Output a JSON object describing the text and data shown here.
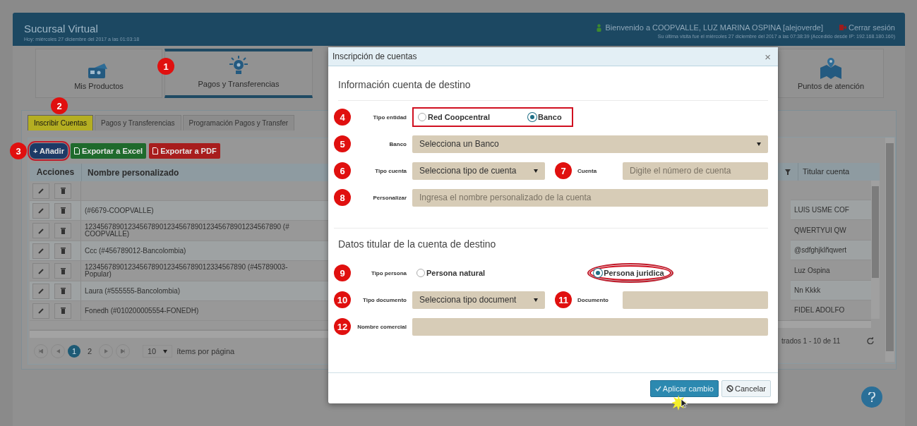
{
  "header": {
    "title": "Sucursal Virtual",
    "date_line": "Hoy: miércoles 27 diciembre del 2017 a las 01:03:18",
    "welcome": "Bienvenido a COOPVALLE, LUZ MARINA OSPINA [alejoverde]",
    "logout": "Cerrar sesión",
    "last_visit": "Su última visita fue el miércoles 27 diciembre del 2017 a las 07:38:39 (Accedido desde IP: 192.168.180.160)"
  },
  "nav": [
    {
      "label": "Mis Productos",
      "kind": "wallet",
      "selected": false
    },
    {
      "label": "Pagos y Transferencias",
      "kind": "bulb",
      "selected": true,
      "marker": "1"
    },
    {
      "label": "Puntos de atención",
      "kind": "map",
      "selected": false
    }
  ],
  "tabs": [
    {
      "label": "Inscribir Cuentas",
      "selected": true,
      "highlighted": true,
      "marker": "2"
    },
    {
      "label": "Pagos y Transferencias",
      "selected": false,
      "highlighted": false
    },
    {
      "label": "Programación Pagos y Transfer",
      "selected": false,
      "highlighted": false
    }
  ],
  "toolbar": [
    {
      "label": "+ Añadir",
      "kind": "add",
      "marker": "3",
      "circled": true
    },
    {
      "label": "Exportar a Excel",
      "kind": "excel",
      "circled": false
    },
    {
      "label": "Exportar a PDF",
      "kind": "pdf",
      "circled": false
    }
  ],
  "table": {
    "columns": [
      "Acciones",
      "Nombre personalizado",
      "Titular cuenta"
    ],
    "rows": [
      {},
      {
        "name": [
          "(#6679-COOPVALLE)"
        ],
        "holder": "LUIS USME COF"
      },
      {
        "name": [
          "12345678901234567890123456789012345678901234567890 (#",
          "COOPVALLE)"
        ],
        "holder": "QWERTYUI QW"
      },
      {
        "name": [
          "Ccc (#456789012-Bancolombia)"
        ],
        "holder": "@sdfghjklñqwert"
      },
      {
        "name": [
          "12345678901234567890123456789012334567890 (#45789003-",
          "Popular)"
        ],
        "holder": "Luz Ospina"
      },
      {
        "name": [
          "Laura (#555555-Bancolombia)"
        ],
        "holder": "Nn Kkkk"
      },
      {
        "name": [
          "Fonedh (#010200005554-FONEDH)"
        ],
        "holder": "FIDEL ADOLFO"
      }
    ]
  },
  "pager": {
    "pages": [
      {
        "label": "1",
        "selected": true
      },
      {
        "label": "2",
        "selected": false
      }
    ],
    "page_size": "10",
    "per_page": "ítems por página",
    "range": "trados 1 - 10 de 11"
  },
  "modal": {
    "title": "Inscripción de cuentas",
    "close": "×",
    "sections": [
      {
        "title": "Información cuenta de destino",
        "rows": [
          {
            "fields": [
              {
                "marker": "4",
                "label": "Tipo entidad",
                "kind": "radio",
                "outline": true,
                "options": [
                  {
                    "label": "Red Coopcentral",
                    "selected": false,
                    "circled": false
                  },
                  {
                    "label": "Banco",
                    "selected": true,
                    "circled": false
                  }
                ]
              }
            ]
          },
          {
            "fields": [
              {
                "marker": "5",
                "label": "Banco",
                "kind": "select",
                "value": "Selecciona un Banco"
              }
            ]
          },
          {
            "fields": [
              {
                "marker": "6",
                "label": "Tipo cuenta",
                "kind": "select",
                "value": "Selecciona tipo de cuenta"
              },
              {
                "marker": "7",
                "label": "Cuenta",
                "kind": "input",
                "placeholder": "Digite el número de cuenta"
              }
            ]
          },
          {
            "fields": [
              {
                "marker": "8",
                "label": "Personalizar",
                "kind": "input",
                "placeholder": "Ingresa el nombre personalizado de la cuenta"
              }
            ]
          }
        ]
      },
      {
        "title": "Datos titular de la cuenta de destino",
        "rows": [
          {
            "fields": [
              {
                "marker": "9",
                "label": "Tipo persona",
                "kind": "radio",
                "outline": false,
                "options": [
                  {
                    "label": "Persona natural",
                    "selected": false,
                    "circled": false
                  },
                  {
                    "label": "Persona juridica",
                    "selected": true,
                    "circled": true
                  }
                ]
              }
            ]
          },
          {
            "fields": [
              {
                "marker": "10",
                "label": "Tipo documento",
                "kind": "select",
                "value": "Selecciona tipo document"
              },
              {
                "marker": "11",
                "label": "Documento",
                "kind": "input"
              }
            ]
          },
          {
            "fields": [
              {
                "marker": "12",
                "label": "Nombre comercial",
                "kind": "input"
              }
            ]
          }
        ]
      }
    ],
    "buttons": [
      {
        "label": "Aplicar cambio",
        "kind": "primary"
      },
      {
        "label": "Cancelar",
        "kind": "cancel"
      }
    ]
  }
}
